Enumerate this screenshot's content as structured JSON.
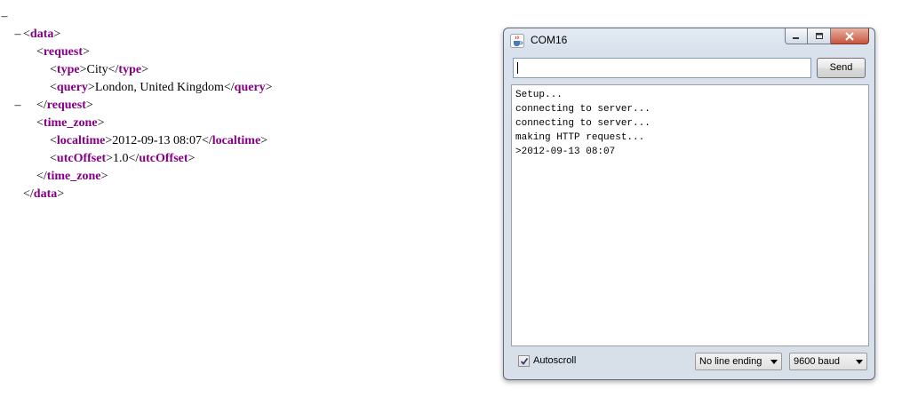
{
  "xml": {
    "lines": [
      {
        "toggle": "–",
        "open": "<",
        "tag": "data",
        "close": ">"
      },
      {
        "toggle": "–",
        "open": "<",
        "tag": "request",
        "close": ">"
      },
      {
        "open": "<",
        "tag": "type",
        "close": ">",
        "text": "City",
        "end_open": "</",
        "end_tag": "type",
        "end_close": ">"
      },
      {
        "open": "<",
        "tag": "query",
        "close": ">",
        "text": "London, United Kingdom",
        "end_open": "</",
        "end_tag": "query",
        "end_close": ">"
      },
      {
        "open": "</",
        "tag": "request",
        "close": ">"
      },
      {
        "toggle": "–",
        "open": "<",
        "tag": "time_zone",
        "close": ">"
      },
      {
        "open": "<",
        "tag": "localtime",
        "close": ">",
        "text": "2012-09-13 08:07",
        "end_open": "</",
        "end_tag": "localtime",
        "end_close": ">"
      },
      {
        "open": "<",
        "tag": "utcOffset",
        "close": ">",
        "text": "1.0",
        "end_open": "</",
        "end_tag": "utcOffset",
        "end_close": ">"
      },
      {
        "open": "</",
        "tag": "time_zone",
        "close": ">"
      },
      {
        "open": "</",
        "tag": "data",
        "close": ">"
      }
    ]
  },
  "serial_monitor": {
    "title": "COM16",
    "input_value": "",
    "send_label": "Send",
    "output_lines": [
      "Setup...",
      "connecting to server...",
      "connecting to server...",
      "making HTTP request...",
      ">2012-09-13 08:07"
    ],
    "autoscroll_label": "Autoscroll",
    "autoscroll_checked": true,
    "line_ending_value": "No line ending",
    "baud_value": "9600 baud"
  },
  "colors": {
    "xml_tag": "#840084",
    "close_button": "#c8553d"
  },
  "icons": [
    "java-cup-icon",
    "minimize-icon",
    "maximize-icon",
    "close-icon",
    "checkmark-icon",
    "dropdown-arrow-icon"
  ]
}
